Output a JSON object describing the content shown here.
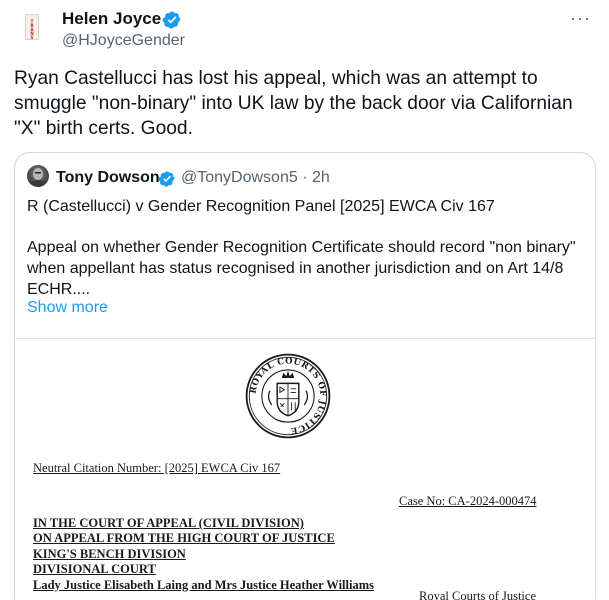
{
  "author": {
    "name": "Helen Joyce",
    "handle": "@HJoyceGender",
    "avatar_book_text": "TRANS",
    "verified_icon": "verified-badge-icon"
  },
  "menu_label": "···",
  "tweet_text": "Ryan Castellucci has lost his appeal, which was an attempt to smuggle \"non-binary\" into UK law by the back door via Californian \"X\" birth certs. Good.",
  "quote": {
    "author_name": "Tony Dowson",
    "handle_time": "@TonyDowson5 · 2h",
    "line1": "R (Castellucci) v Gender Recognition Panel [2025] EWCA Civ 167",
    "body": "Appeal on whether Gender Recognition Certificate should record \"non binary\" when appellant has status recognised in another jurisdiction and on Art 14/8 ECHR....",
    "show_more": "Show more"
  },
  "document": {
    "seal_text": "ROYAL COURTS OF JUSTICE",
    "citation": "Neutral Citation Number: [2025] EWCA Civ 167",
    "case_no": "Case No: CA-2024-000474",
    "court_lines": [
      "IN THE COURT OF APPEAL (CIVIL DIVISION)",
      "ON APPEAL FROM THE HIGH COURT OF JUSTICE",
      "KING'S BENCH DIVISION",
      "DIVISIONAL COURT",
      "Lady Justice Elisabeth Laing and Mrs Justice Heather Williams"
    ],
    "royal_courts": "Royal Courts of Justice"
  },
  "colors": {
    "accent": "#1d9bf0",
    "text": "#0f1419",
    "secondary": "#536471",
    "border": "#cfd9de"
  }
}
